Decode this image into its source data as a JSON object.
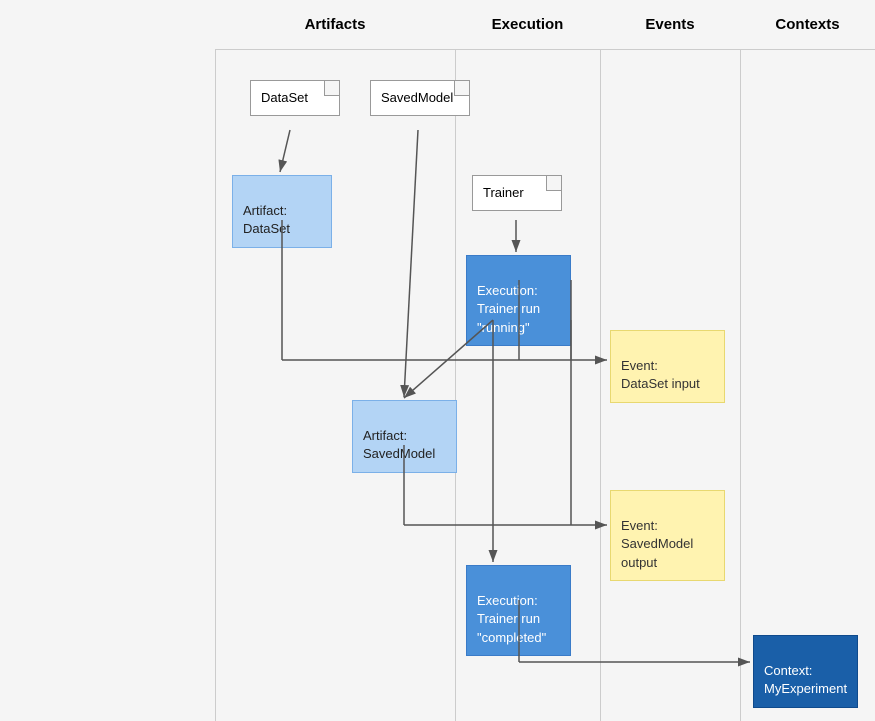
{
  "columns": {
    "artifacts": "Artifacts",
    "execution": "Execution",
    "events": "Events",
    "contexts": "Contexts"
  },
  "nodes": {
    "dataset_type": "DataSet",
    "savedmodel_type": "SavedModel",
    "artifact_dataset": "Artifact:\nDataSet",
    "trainer_type": "Trainer",
    "execution_running": "Execution:\nTrainer run\n\"running\"",
    "event_dataset_input": "Event:\nDataSet input",
    "artifact_savedmodel": "Artifact:\nSavedModel",
    "event_savedmodel_output": "Event:\nSavedModel\noutput",
    "execution_completed": "Execution:\nTrainer run\n\"completed\"",
    "context_myexperiment": "Context:\nMyExperiment"
  }
}
